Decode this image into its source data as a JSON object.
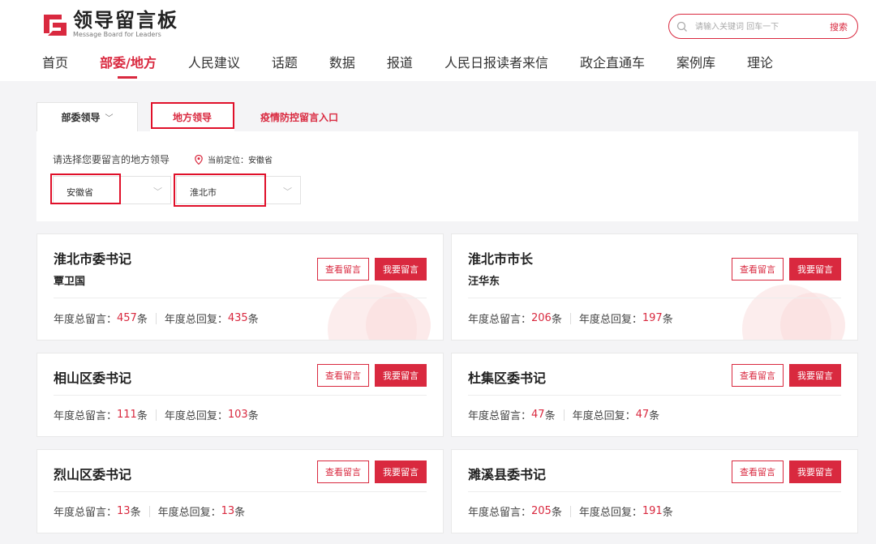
{
  "header": {
    "logo_title": "领导留言板",
    "logo_subtitle": "Message Board for Leaders",
    "search": {
      "placeholder": "请输入关键词 回车一下",
      "button": "搜索"
    },
    "nav": [
      "首页",
      "部委/地方",
      "人民建议",
      "话题",
      "数据",
      "报道",
      "人民日报读者来信",
      "政企直通车",
      "案例库",
      "理论"
    ],
    "nav_active": "部委/地方"
  },
  "tabs": {
    "ministry": "部委领导",
    "local": "地方领导",
    "epidemic": "疫情防控留言入口"
  },
  "filter": {
    "label": "请选择您要留言的地方领导",
    "location": "当前定位：安徽省",
    "province": "安徽省",
    "city": "淮北市"
  },
  "labels": {
    "view": "查看留言",
    "post": "我要留言",
    "total_messages": "年度总留言：",
    "total_replies": "年度总回复：",
    "unit": "条"
  },
  "cards": [
    {
      "title": "淮北市委书记",
      "name": "覃卫国",
      "messages": "457",
      "replies": "435"
    },
    {
      "title": "淮北市市长",
      "name": "汪华东",
      "messages": "206",
      "replies": "197"
    },
    {
      "title": "相山区委书记",
      "name": "",
      "messages": "111",
      "replies": "103"
    },
    {
      "title": "杜集区委书记",
      "name": "",
      "messages": "47",
      "replies": "47"
    },
    {
      "title": "烈山区委书记",
      "name": "",
      "messages": "13",
      "replies": "13"
    },
    {
      "title": "濉溪县委书记",
      "name": "",
      "messages": "205",
      "replies": "191"
    }
  ],
  "colors": {
    "accent": "#d9293f",
    "highlight": "#e0102a"
  }
}
